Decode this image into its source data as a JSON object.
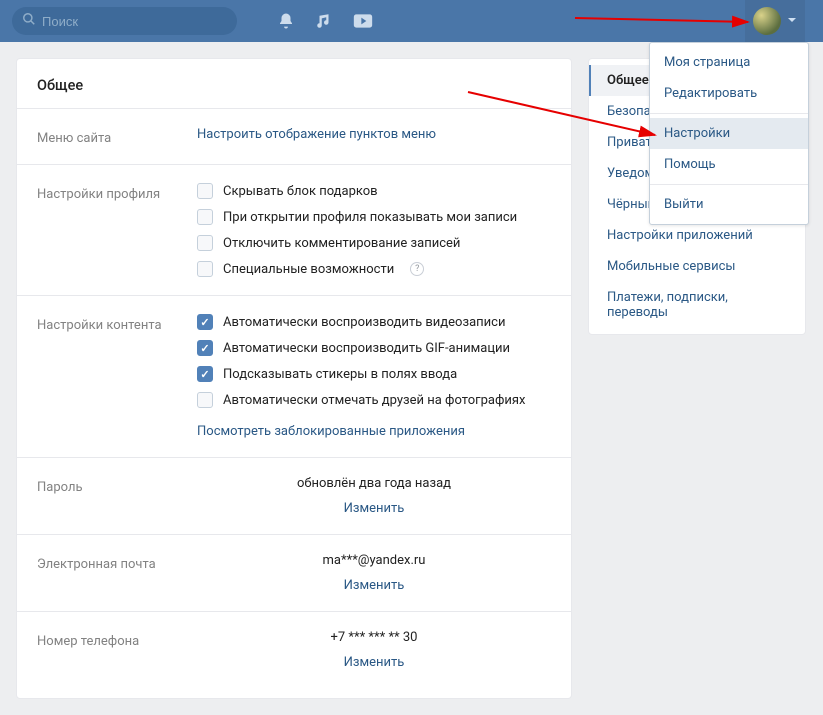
{
  "topbar": {
    "search_placeholder": "Поиск"
  },
  "dropdown": {
    "my_page": "Моя страница",
    "edit": "Редактировать",
    "settings": "Настройки",
    "help": "Помощь",
    "logout": "Выйти"
  },
  "sidenav": {
    "general": "Общее",
    "security": "Безопасн",
    "privacy": "Приватно",
    "notifications": "Уведомл",
    "blacklist": "Чёрный с",
    "app_settings": "Настройки приложений",
    "mobile": "Мобильные сервисы",
    "payments": "Платежи, подписки, переводы"
  },
  "card": {
    "header": "Общее",
    "menu": {
      "label": "Меню сайта",
      "configure": "Настроить отображение пунктов меню"
    },
    "profile": {
      "label": "Настройки профиля",
      "hide_gifts": "Скрывать блок подарков",
      "show_my_posts": "При открытии профиля показывать мои записи",
      "disable_comments": "Отключить комментирование записей",
      "accessibility": "Специальные возможности",
      "checks": {
        "hide_gifts": false,
        "show_my_posts": false,
        "disable_comments": false,
        "accessibility": false
      }
    },
    "content": {
      "label": "Настройки контента",
      "autoplay_video": "Автоматически воспроизводить видеозаписи",
      "autoplay_gif": "Автоматически воспроизводить GIF-анимации",
      "suggest_stickers": "Подсказывать стикеры в полях ввода",
      "tag_friends": "Автоматически отмечать друзей на фотографиях",
      "blocked_apps": "Посмотреть заблокированные приложения",
      "checks": {
        "autoplay_video": true,
        "autoplay_gif": true,
        "suggest_stickers": true,
        "tag_friends": false
      }
    },
    "password": {
      "label": "Пароль",
      "value": "обновлён два года назад",
      "action": "Изменить"
    },
    "email": {
      "label": "Электронная почта",
      "value": "ma***@yandex.ru",
      "action": "Изменить"
    },
    "phone": {
      "label": "Номер телефона",
      "value": "+7 *** *** ** 30",
      "action": "Изменить"
    }
  }
}
